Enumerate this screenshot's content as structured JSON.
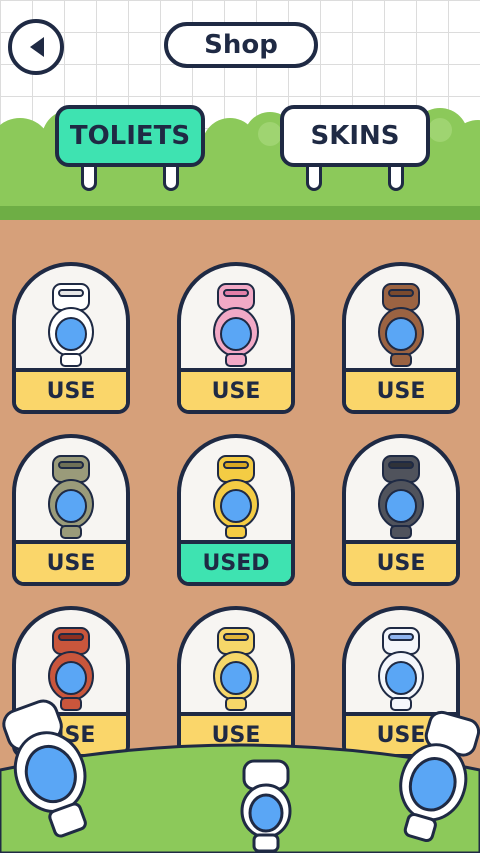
{
  "header": {
    "title": "Shop",
    "back_icon": "back-arrow-icon"
  },
  "tabs": [
    {
      "label": "TOLIETS",
      "active": true
    },
    {
      "label": "SKINS",
      "active": false
    }
  ],
  "items": [
    {
      "name": "white-toilet",
      "button": "USE",
      "state": "use",
      "body": "#ffffff",
      "accent": "#e6e6e6"
    },
    {
      "name": "pink-toilet",
      "button": "USE",
      "state": "use",
      "body": "#f2a9c6",
      "accent": "#e37fa8"
    },
    {
      "name": "wooden-toilet",
      "button": "USE",
      "state": "use",
      "body": "#9b6342",
      "accent": "#7a4a2e"
    },
    {
      "name": "olive-toilet",
      "button": "USE",
      "state": "use",
      "body": "#9a9b7a",
      "accent": "#6f7057"
    },
    {
      "name": "golden-toilet",
      "button": "USED",
      "state": "used",
      "body": "#f4cc44",
      "accent": "#d9a823"
    },
    {
      "name": "robot-toilet",
      "button": "USE",
      "state": "use",
      "body": "#50535c",
      "accent": "#2f3239"
    },
    {
      "name": "devil-toilet",
      "button": "USE",
      "state": "use",
      "body": "#c9563c",
      "accent": "#8c2f21"
    },
    {
      "name": "winged-gold-toilet",
      "button": "USE",
      "state": "use",
      "body": "#f6d769",
      "accent": "#e0b53a"
    },
    {
      "name": "angel-toilet",
      "button": "USE",
      "state": "use",
      "body": "#f4f6fb",
      "accent": "#8fb4f0"
    }
  ],
  "colors": {
    "outline": "#1f2a44",
    "active_tab": "#3ee3b1",
    "use_button": "#fad66a",
    "used_button": "#3ee3b1",
    "dirt": "#d6a07a",
    "grass": "#8cc95a",
    "water": "#5aa6f5"
  }
}
